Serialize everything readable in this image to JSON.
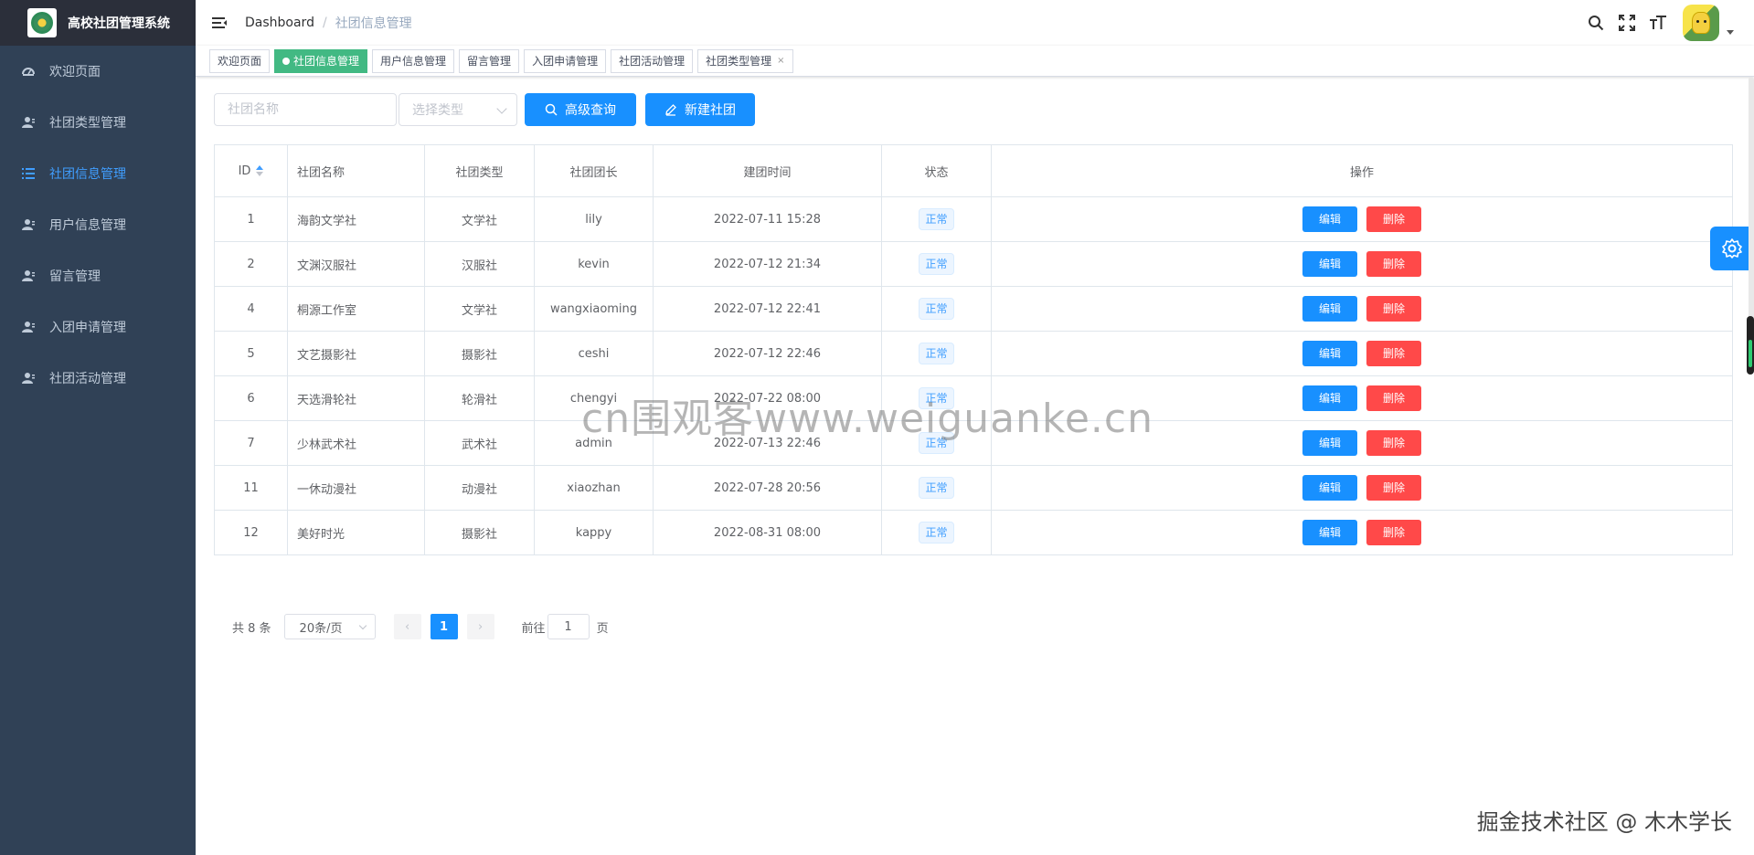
{
  "app": {
    "title": "高校社团管理系统"
  },
  "sidebar": {
    "items": [
      {
        "label": "欢迎页面",
        "icon": "dashboard-icon",
        "active": false
      },
      {
        "label": "社团类型管理",
        "icon": "user-icon",
        "active": false
      },
      {
        "label": "社团信息管理",
        "icon": "list-icon",
        "active": true
      },
      {
        "label": "用户信息管理",
        "icon": "user-icon",
        "active": false
      },
      {
        "label": "留言管理",
        "icon": "user-icon",
        "active": false
      },
      {
        "label": "入团申请管理",
        "icon": "user-icon",
        "active": false
      },
      {
        "label": "社团活动管理",
        "icon": "user-icon",
        "active": false
      }
    ]
  },
  "header": {
    "breadcrumb": {
      "home": "Dashboard",
      "separator": "/",
      "current": "社团信息管理"
    }
  },
  "tags": [
    {
      "label": "欢迎页面",
      "active": false,
      "closable": false
    },
    {
      "label": "社团信息管理",
      "active": true,
      "closable": false
    },
    {
      "label": "用户信息管理",
      "active": false,
      "closable": false
    },
    {
      "label": "留言管理",
      "active": false,
      "closable": false
    },
    {
      "label": "入团申请管理",
      "active": false,
      "closable": false
    },
    {
      "label": "社团活动管理",
      "active": false,
      "closable": false
    },
    {
      "label": "社团类型管理",
      "active": false,
      "closable": true,
      "close_glyph": "×"
    }
  ],
  "filter": {
    "name_placeholder": "社团名称",
    "type_placeholder": "选择类型",
    "search_label": "高级查询",
    "create_label": "新建社团"
  },
  "table": {
    "columns": [
      "ID",
      "社团名称",
      "社团类型",
      "社团团长",
      "建团时间",
      "状态",
      "操作"
    ],
    "rows": [
      {
        "id": "1",
        "name": "海韵文学社",
        "type": "文学社",
        "leader": "lily",
        "time": "2022-07-11 15:28",
        "status": "正常"
      },
      {
        "id": "2",
        "name": "文渊汉服社",
        "type": "汉服社",
        "leader": "kevin",
        "time": "2022-07-12 21:34",
        "status": "正常"
      },
      {
        "id": "4",
        "name": "桐源工作室",
        "type": "文学社",
        "leader": "wangxiaoming",
        "time": "2022-07-12 22:41",
        "status": "正常"
      },
      {
        "id": "5",
        "name": "文艺摄影社",
        "type": "摄影社",
        "leader": "ceshi",
        "time": "2022-07-12 22:46",
        "status": "正常"
      },
      {
        "id": "6",
        "name": "天选滑轮社",
        "type": "轮滑社",
        "leader": "chengyi",
        "time": "2022-07-22 08:00",
        "status": "正常"
      },
      {
        "id": "7",
        "name": "少林武术社",
        "type": "武术社",
        "leader": "admin",
        "time": "2022-07-13 22:46",
        "status": "正常"
      },
      {
        "id": "11",
        "name": "一休动漫社",
        "type": "动漫社",
        "leader": "xiaozhan",
        "time": "2022-07-28 20:56",
        "status": "正常"
      },
      {
        "id": "12",
        "name": "美好时光",
        "type": "摄影社",
        "leader": "kappy",
        "time": "2022-08-31 08:00",
        "status": "正常"
      }
    ],
    "edit_label": "编辑",
    "delete_label": "删除"
  },
  "pagination": {
    "total_text": "共 8 条",
    "page_size": "20条/页",
    "current_page": "1",
    "goto_prefix": "前往",
    "goto_value": "1",
    "goto_suffix": "页",
    "prev_glyph": "‹",
    "next_glyph": "›"
  },
  "watermarks": {
    "center": "cn围观客www.weiguanke.cn",
    "corner": "掘金技术社区 @ 木木学长"
  },
  "colors": {
    "sidebar_bg": "#304156",
    "accent": "#1890ff",
    "danger": "#ff4949",
    "active_tag": "#42b983",
    "active_menu": "#409eff"
  }
}
